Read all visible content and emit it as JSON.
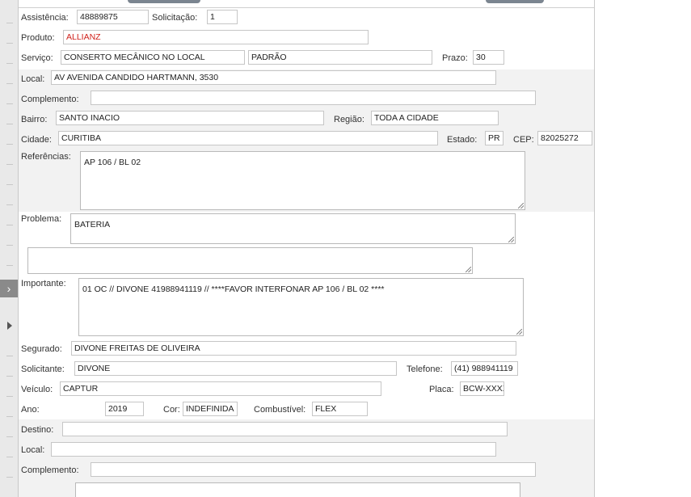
{
  "form": {
    "assistencia": {
      "label": "Assistência:",
      "value": "48889875"
    },
    "solicitacao": {
      "label": "Solicitação:",
      "value": "1"
    },
    "produto": {
      "label": "Produto:",
      "value": "ALLIANZ"
    },
    "servico": {
      "label": "Serviço:",
      "value": "CONSERTO MECÂNICO NO LOCAL",
      "tipo": "PADRÃO"
    },
    "prazo": {
      "label": "Prazo:",
      "value": "30"
    },
    "local": {
      "label": "Local:",
      "value": "AV AVENIDA CANDIDO HARTMANN, 3530"
    },
    "complemento": {
      "label": "Complemento:",
      "value": ""
    },
    "bairro": {
      "label": "Bairro:",
      "value": "SANTO INACIO"
    },
    "regiao": {
      "label": "Região:",
      "value": "TODA A CIDADE"
    },
    "cidade": {
      "label": "Cidade:",
      "value": "CURITIBA"
    },
    "estado": {
      "label": "Estado:",
      "value": "PR"
    },
    "cep": {
      "label": "CEP:",
      "value": "82025272"
    },
    "referencias": {
      "label": "Referências:",
      "value": "AP 106 / BL 02"
    },
    "problema": {
      "label": "Problema:",
      "value": "BATERIA",
      "extra": ""
    },
    "importante": {
      "label": "Importante:",
      "value": "01 OC // DIVONE 41988941119 // ****FAVOR INTERFONAR AP 106 / BL 02 ****"
    },
    "segurado": {
      "label": "Segurado:",
      "value": "DIVONE FREITAS DE OLIVEIRA"
    },
    "solicitante": {
      "label": "Solicitante:",
      "value": "DIVONE"
    },
    "telefone": {
      "label": "Telefone:",
      "value": "(41) 988941119"
    },
    "veiculo": {
      "label": "Veículo:",
      "value": "CAPTUR"
    },
    "placa": {
      "label": "Placa:",
      "value": "BCW-XXXX"
    },
    "ano": {
      "label": "Ano:",
      "value": "2019"
    },
    "cor": {
      "label": "Cor:",
      "value": "INDEFINIDA"
    },
    "combustivel": {
      "label": "Combustível:",
      "value": "FLEX"
    },
    "destino": {
      "label": "Destino:",
      "value": ""
    },
    "destino_local": {
      "label": "Local:",
      "value": ""
    },
    "destino_complemento": {
      "label": "Complemento:",
      "value": ""
    }
  },
  "sidebar": {
    "expand_icon": "chevron-right-icon",
    "arrow_icon": "triangle-right-icon"
  },
  "colors": {
    "required_text": "#d0211b",
    "band_bg": "#f2f2f2"
  }
}
